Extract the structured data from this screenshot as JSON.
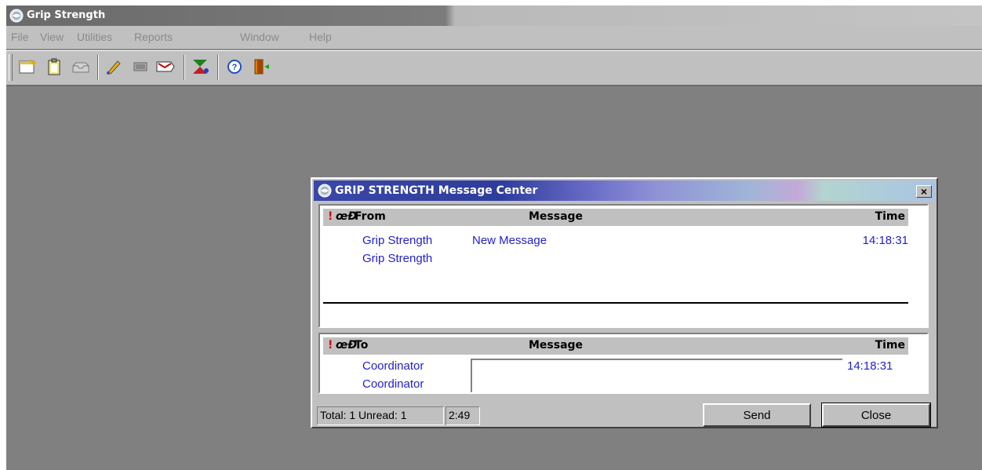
{
  "app": {
    "title": "Grip Strength",
    "icon": "grip-strength-logo-icon"
  },
  "menu": [
    "File",
    "View",
    "Utilities",
    "Reports",
    "Window",
    "Help"
  ],
  "toolbar": {
    "buttons": [
      "new-message-icon",
      "clipboard-icon",
      "inbox-tray-icon",
      "edit-pencil-icon",
      "card-icon",
      "mail-tag-icon",
      "users-icon",
      "help-icon",
      "exit-door-icon"
    ]
  },
  "dialog": {
    "title": "GRIP STRENGTH Message Center",
    "close_label": "×",
    "incoming": {
      "headers": {
        "priority": "!",
        "attach": "œÐ",
        "from": "From",
        "message": "Message",
        "time": "Time"
      },
      "rows": [
        {
          "from": "Grip Strength",
          "message": "New Message",
          "time": "14:18:31"
        },
        {
          "from": "Grip Strength",
          "message": "",
          "time": ""
        }
      ]
    },
    "outgoing": {
      "headers": {
        "priority": "!",
        "attach": "œÐ",
        "to": "To",
        "message": "Message",
        "time": "Time"
      },
      "rows": [
        {
          "to": "Coordinator",
          "time": "14:18:31"
        },
        {
          "to": "Coordinator",
          "time": ""
        }
      ],
      "message_value": ""
    },
    "status": {
      "totals": "Total: 1 Unread: 1",
      "clock": "2:49"
    },
    "buttons": {
      "send": "Send",
      "close": "Close"
    }
  },
  "colors": {
    "link_blue": "#1f1fd0",
    "priority_red": "#e00000",
    "workspace_gray": "#808080"
  }
}
